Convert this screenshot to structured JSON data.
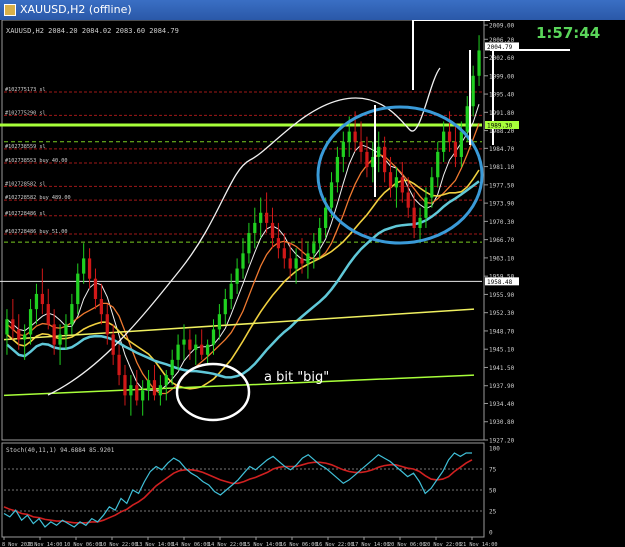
{
  "window": {
    "title": "XAUUSD,H2 (offline)"
  },
  "chart_data": {
    "type": "line",
    "symbol_header": "XAUUSD,H2 2084.20 2084.02 2083.60 2084.79",
    "timer": "1:57:44",
    "annotation": "a bit \"big\"",
    "price_axis": {
      "ylim": [
        1927.2,
        2010.0
      ],
      "ticks": [
        "2009.00",
        "2006.20",
        "2002.60",
        "1999.00",
        "1995.40",
        "1991.80",
        "1988.20",
        "1984.70",
        "1981.10",
        "1977.50",
        "1973.90",
        "1970.30",
        "1966.70",
        "1963.10",
        "1959.50",
        "1955.90",
        "1952.30",
        "1948.70",
        "1945.10",
        "1941.50",
        "1937.90",
        "1934.40",
        "1930.80",
        "1927.20"
      ],
      "current_label": "2004.79",
      "level_label": "1989.30",
      "low_label": "1958.48"
    },
    "time_axis": [
      "8 Nov 2023",
      "9 Nov 14:00",
      "10 Nov 06:00",
      "10 Nov 22:00",
      "13 Nov 14:00",
      "14 Nov 06:00",
      "14 Nov 22:00",
      "15 Nov 14:00",
      "16 Nov 06:00",
      "16 Nov 22:00",
      "17 Nov 14:00",
      "20 Nov 06:00",
      "20 Nov 22:00",
      "21 Nov 14:00"
    ],
    "orders": [
      "#102775173 sl",
      "#102775290 sl",
      "#102738559 sl",
      "#102738553 buy 40.00",
      "#102728582 sl",
      "#102728582 buy 489.00",
      "#102728486 sl",
      "#102728486 buy 51.00"
    ],
    "candles": [
      [
        1948,
        1953,
        1944,
        1951
      ],
      [
        1951,
        1955,
        1947,
        1949
      ],
      [
        1949,
        1952,
        1945,
        1947
      ],
      [
        1947,
        1950,
        1943,
        1948
      ],
      [
        1948,
        1955,
        1946,
        1953
      ],
      [
        1953,
        1958,
        1950,
        1956
      ],
      [
        1956,
        1961,
        1952,
        1954
      ],
      [
        1954,
        1957,
        1949,
        1950
      ],
      [
        1950,
        1953,
        1944,
        1946
      ],
      [
        1946,
        1950,
        1942,
        1948
      ],
      [
        1948,
        1952,
        1945,
        1950
      ],
      [
        1950,
        1956,
        1948,
        1954
      ],
      [
        1954,
        1962,
        1952,
        1960
      ],
      [
        1960,
        1966,
        1958,
        1963
      ],
      [
        1963,
        1965,
        1957,
        1959
      ],
      [
        1959,
        1961,
        1953,
        1955
      ],
      [
        1955,
        1958,
        1950,
        1952
      ],
      [
        1952,
        1954,
        1946,
        1948
      ],
      [
        1948,
        1950,
        1942,
        1944
      ],
      [
        1944,
        1946,
        1938,
        1940
      ],
      [
        1940,
        1942,
        1934,
        1936
      ],
      [
        1936,
        1940,
        1932,
        1938
      ],
      [
        1938,
        1941,
        1934,
        1935
      ],
      [
        1935,
        1939,
        1932,
        1937
      ],
      [
        1937,
        1941,
        1935,
        1939
      ],
      [
        1939,
        1942,
        1935,
        1936
      ],
      [
        1936,
        1940,
        1934,
        1938
      ],
      [
        1938,
        1941,
        1935,
        1940
      ],
      [
        1940,
        1945,
        1938,
        1943
      ],
      [
        1943,
        1948,
        1941,
        1946
      ],
      [
        1946,
        1950,
        1943,
        1947
      ],
      [
        1947,
        1949,
        1943,
        1945
      ],
      [
        1945,
        1948,
        1942,
        1946
      ],
      [
        1946,
        1949,
        1943,
        1944
      ],
      [
        1944,
        1947,
        1942,
        1946
      ],
      [
        1946,
        1951,
        1944,
        1949
      ],
      [
        1949,
        1954,
        1947,
        1952
      ],
      [
        1952,
        1957,
        1950,
        1955
      ],
      [
        1955,
        1960,
        1953,
        1958
      ],
      [
        1958,
        1963,
        1956,
        1961
      ],
      [
        1961,
        1967,
        1959,
        1964
      ],
      [
        1964,
        1970,
        1962,
        1968
      ],
      [
        1968,
        1973,
        1965,
        1970
      ],
      [
        1970,
        1975,
        1967,
        1972
      ],
      [
        1972,
        1976,
        1968,
        1970
      ],
      [
        1970,
        1973,
        1965,
        1967
      ],
      [
        1967,
        1970,
        1963,
        1965
      ],
      [
        1965,
        1968,
        1961,
        1963
      ],
      [
        1963,
        1966,
        1959,
        1961
      ],
      [
        1961,
        1965,
        1958,
        1963
      ],
      [
        1963,
        1967,
        1960,
        1962
      ],
      [
        1962,
        1966,
        1959,
        1964
      ],
      [
        1964,
        1968,
        1961,
        1966
      ],
      [
        1966,
        1971,
        1963,
        1969
      ],
      [
        1969,
        1975,
        1967,
        1973
      ],
      [
        1973,
        1980,
        1971,
        1978
      ],
      [
        1978,
        1985,
        1976,
        1983
      ],
      [
        1983,
        1988,
        1980,
        1986
      ],
      [
        1986,
        1991,
        1983,
        1988
      ],
      [
        1988,
        1992,
        1984,
        1986
      ],
      [
        1986,
        1990,
        1982,
        1984
      ],
      [
        1984,
        1987,
        1979,
        1981
      ],
      [
        1981,
        1986,
        1978,
        1983
      ],
      [
        1983,
        1988,
        1980,
        1985
      ],
      [
        1985,
        1987,
        1978,
        1980
      ],
      [
        1980,
        1983,
        1975,
        1977
      ],
      [
        1977,
        1981,
        1973,
        1979
      ],
      [
        1979,
        1982,
        1974,
        1976
      ],
      [
        1976,
        1979,
        1971,
        1973
      ],
      [
        1973,
        1976,
        1967,
        1969
      ],
      [
        1969,
        1973,
        1966,
        1971
      ],
      [
        1971,
        1977,
        1969,
        1975
      ],
      [
        1975,
        1981,
        1973,
        1979
      ],
      [
        1979,
        1986,
        1977,
        1984
      ],
      [
        1984,
        1990,
        1982,
        1988
      ],
      [
        1988,
        1992,
        1984,
        1986
      ],
      [
        1986,
        1989,
        1981,
        1983
      ],
      [
        1983,
        1990,
        1981,
        1988
      ],
      [
        1988,
        1995,
        1986,
        1993
      ],
      [
        1993,
        2001,
        1991,
        1999
      ],
      [
        1999,
        2007,
        1997,
        2004
      ]
    ],
    "stoch": {
      "label": "Stoch(40,11,1) 94.6884 85.9201",
      "ylim": [
        0,
        100
      ],
      "ticks": [
        "100",
        "75",
        "50",
        "25",
        "0"
      ],
      "main": [
        22,
        18,
        26,
        14,
        20,
        10,
        16,
        6,
        12,
        8,
        14,
        10,
        6,
        12,
        8,
        16,
        12,
        20,
        30,
        26,
        40,
        34,
        50,
        46,
        60,
        72,
        78,
        74,
        82,
        88,
        84,
        76,
        70,
        66,
        60,
        56,
        48,
        44,
        50,
        56,
        62,
        70,
        78,
        74,
        80,
        86,
        90,
        84,
        78,
        74,
        80,
        88,
        92,
        86,
        80,
        76,
        70,
        64,
        58,
        62,
        68,
        74,
        80,
        86,
        92,
        88,
        84,
        78,
        72,
        66,
        70,
        60,
        46,
        52,
        62,
        72,
        86,
        94,
        90,
        94,
        94
      ],
      "signal": [
        30,
        27,
        25,
        22,
        21,
        18,
        17,
        15,
        14,
        13,
        13,
        12,
        11,
        11,
        11,
        12,
        12,
        14,
        17,
        20,
        24,
        27,
        32,
        36,
        41,
        48,
        55,
        60,
        65,
        70,
        73,
        74,
        74,
        73,
        71,
        68,
        65,
        62,
        60,
        58,
        58,
        60,
        63,
        65,
        68,
        71,
        75,
        77,
        78,
        78,
        78,
        80,
        82,
        83,
        83,
        82,
        80,
        77,
        74,
        72,
        71,
        71,
        72,
        74,
        77,
        79,
        80,
        80,
        78,
        76,
        75,
        72,
        67,
        63,
        62,
        63,
        66,
        72,
        77,
        82,
        86
      ]
    }
  }
}
